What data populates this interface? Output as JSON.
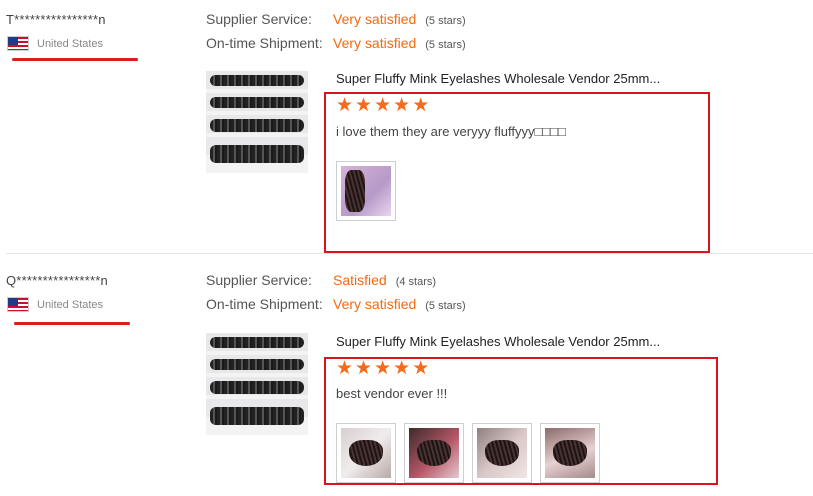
{
  "labels": {
    "supplier_service": "Supplier Service:",
    "ontime_shipment": "On-time Shipment:"
  },
  "reviews": [
    {
      "buyer": "T****************n",
      "country": "United States",
      "flag_icon": "us-flag-icon",
      "supplier_service": {
        "value": "Very satisfied",
        "stars_text": "(5 stars)",
        "stars": 5
      },
      "ontime_shipment": {
        "value": "Very satisfied",
        "stars_text": "(5 stars)",
        "stars": 5
      },
      "product_title": "Super Fluffy Mink Eyelashes Wholesale Vendor 25mm...",
      "rating": 5,
      "comment": "i love them they are veryyy fluffyyy□□□□",
      "photos": 1
    },
    {
      "buyer": "Q****************n",
      "country": "United States",
      "flag_icon": "us-flag-icon",
      "supplier_service": {
        "value": "Satisfied",
        "stars_text": "(4 stars)",
        "stars": 4
      },
      "ontime_shipment": {
        "value": "Very satisfied",
        "stars_text": "(5 stars)",
        "stars": 5
      },
      "product_title": "Super Fluffy Mink Eyelashes Wholesale Vendor 25mm...",
      "rating": 5,
      "comment": "best vendor ever !!!",
      "photos": 4
    }
  ],
  "colors": {
    "accent": "#f26a10",
    "star": "#f56a1b",
    "highlight": "#d9141e"
  },
  "star_glyph": "★"
}
